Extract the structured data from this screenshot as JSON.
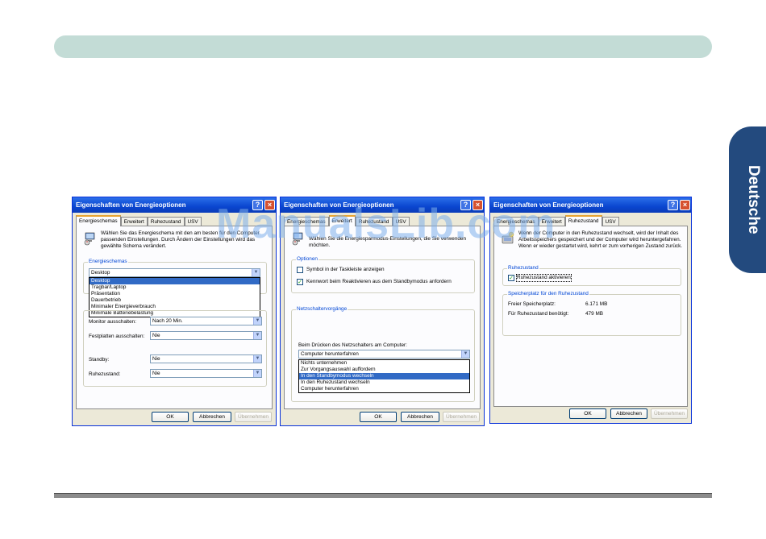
{
  "side_tab": {
    "label": "Deutsche"
  },
  "watermark": "ManualsLib.com",
  "dialog1": {
    "title": "Eigenschaften von Energieoptionen",
    "tabs": [
      "Energieschemas",
      "Erweitert",
      "Ruhezustand",
      "USV"
    ],
    "description": "Wählen Sie das Energieschema mit den am besten für den Computer passenden Einstellungen. Durch Ändern der Einstellungen wird das gewählte Schema verändert.",
    "group_label": "Energieschemas",
    "scheme_value": "Desktop",
    "scheme_options": [
      "Desktop",
      "Tragbar/Laptop",
      "Präsentation",
      "Dauerbetrieb",
      "Minimaler Energieverbrauch",
      "Minimale Batteriebelastung"
    ],
    "settings": [
      {
        "label": "Monitor ausschalten:",
        "value": "Nach 20 Min."
      },
      {
        "label": "Festplatten ausschalten:",
        "value": "Nie"
      },
      {
        "label": "Standby:",
        "value": "Nie"
      },
      {
        "label": "Ruhezustand:",
        "value": "Nie"
      }
    ],
    "buttons": {
      "ok": "OK",
      "cancel": "Abbrechen",
      "apply": "Übernehmen"
    }
  },
  "dialog2": {
    "title": "Eigenschaften von Energieoptionen",
    "tabs": [
      "Energieschemas",
      "Erweitert",
      "Ruhezustand",
      "USV"
    ],
    "description": "Wählen Sie die Energiesparmodus-Einstellungen, die Sie verwenden möchten.",
    "options_label": "Optionen",
    "options": [
      {
        "label": "Symbol in der Taskleiste anzeigen",
        "checked": false
      },
      {
        "label": "Kennwort beim Reaktivieren aus dem Standbymodus anfordern",
        "checked": true
      }
    ],
    "power_buttons_label": "Netzschaltervorgänge",
    "power_button_caption": "Beim Drücken des Netzschalters am Computer:",
    "power_button_value": "Computer herunterfahren",
    "power_button_options": [
      "Nichts unternehmen",
      "Zur Vorgangsauswahl auffordern",
      "In den Standbymodus wechseln",
      "In den Ruhezustand wechseln",
      "Computer herunterfahren"
    ],
    "buttons": {
      "ok": "OK",
      "cancel": "Abbrechen",
      "apply": "Übernehmen"
    }
  },
  "dialog3": {
    "title": "Eigenschaften von Energieoptionen",
    "tabs": [
      "Energieschemas",
      "Erweitert",
      "Ruhezustand",
      "USV"
    ],
    "description": "Wenn der Computer in den Ruhezustand wechselt, wird der Inhalt des Arbeitsspeichers gespeichert und der Computer wird heruntergefahren. Wenn er wieder gestartet wird, kehrt er zum vorherigen Zustand zurück.",
    "hibernate_label": "Ruhezustand",
    "hibernate_checkbox": "Ruhezustand aktivieren",
    "disk_label": "Speicherplatz für den Ruhezustand",
    "free_space_label": "Freier Speicherplatz:",
    "free_space_value": "6.171 MB",
    "required_label": "Für Ruhezustand benötigt:",
    "required_value": "479 MB",
    "buttons": {
      "ok": "OK",
      "cancel": "Abbrechen",
      "apply": "Übernehmen"
    }
  },
  "colors": {
    "header_bar": "#c3dcd6",
    "side_tab": "#234a7e",
    "xp_title": "#0a46d0",
    "selection": "#316ac5"
  }
}
